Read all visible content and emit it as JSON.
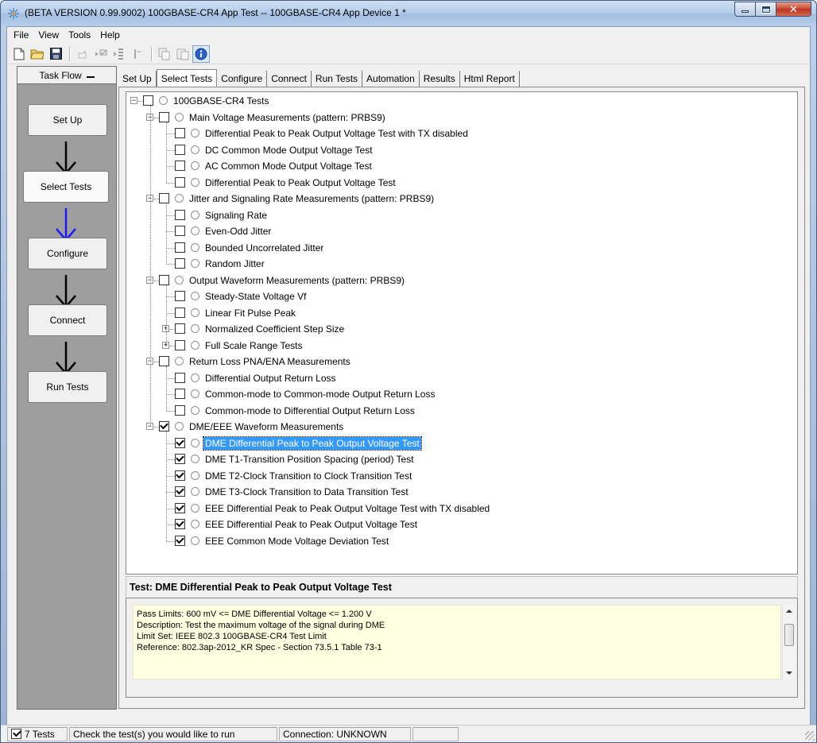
{
  "window": {
    "title": "(BETA VERSION 0.99.9002) 100GBASE-CR4 App Test -- 100GBASE-CR4 App Device 1 *",
    "app_icon": "sparkle-icon",
    "controls": {
      "minimize": "minimize-icon",
      "maximize": "maximize-icon",
      "close": "close-icon"
    }
  },
  "menu": [
    "File",
    "View",
    "Tools",
    "Help"
  ],
  "toolbar": {
    "buttons": [
      "new-file-icon",
      "open-folder-icon",
      "save-icon",
      "stop-icon",
      "run-selected-icon",
      "run-step-icon",
      "pause-icon",
      "copy-icon",
      "paste-icon",
      "info-icon"
    ]
  },
  "taskflow": {
    "header": "Task Flow",
    "steps": [
      "Set Up",
      "Select Tests",
      "Configure",
      "Connect",
      "Run Tests"
    ],
    "current_step": "Select Tests",
    "colors": {
      "arrow": "#000000",
      "current_arrow": "#1a1aff"
    }
  },
  "tabs": [
    "Set Up",
    "Select Tests",
    "Configure",
    "Connect",
    "Run Tests",
    "Automation",
    "Results",
    "Html Report"
  ],
  "active_tab": "Select Tests",
  "tree": {
    "root": {
      "label": "100GBASE-CR4 Tests",
      "checked": false
    },
    "groups": [
      {
        "label": "Main Voltage Measurements (pattern: PRBS9)",
        "checked": false,
        "items": [
          {
            "label": "Differential Peak to Peak Output Voltage Test with TX disabled",
            "checked": false
          },
          {
            "label": "DC Common Mode Output Voltage Test",
            "checked": false
          },
          {
            "label": "AC Common Mode Output Voltage Test",
            "checked": false
          },
          {
            "label": "Differential Peak to Peak Output Voltage Test",
            "checked": false
          }
        ]
      },
      {
        "label": "Jitter and Signaling Rate Measurements (pattern: PRBS9)",
        "checked": false,
        "items": [
          {
            "label": "Signaling Rate",
            "checked": false
          },
          {
            "label": "Even-Odd Jitter",
            "checked": false
          },
          {
            "label": "Bounded Uncorrelated Jitter",
            "checked": false
          },
          {
            "label": "Random Jitter",
            "checked": false
          }
        ]
      },
      {
        "label": "Output Waveform Measurements (pattern: PRBS9)",
        "checked": false,
        "items": [
          {
            "label": "Steady-State Voltage Vf",
            "checked": false
          },
          {
            "label": "Linear Fit Pulse Peak",
            "checked": false
          },
          {
            "label": "Normalized Coefficient Step Size",
            "checked": false,
            "expandable": true
          },
          {
            "label": "Full Scale Range Tests",
            "checked": false,
            "expandable": true
          }
        ]
      },
      {
        "label": "Return Loss PNA/ENA Measurements",
        "checked": false,
        "items": [
          {
            "label": "Differential Output Return Loss",
            "checked": false
          },
          {
            "label": "Common-mode to Common-mode Output Return Loss",
            "checked": false
          },
          {
            "label": "Common-mode to Differential Output Return Loss",
            "checked": false
          }
        ]
      },
      {
        "label": "DME/EEE Waveform Measurements",
        "checked": true,
        "items": [
          {
            "label": "DME Differential Peak to Peak Output Voltage Test",
            "checked": true,
            "selected": true
          },
          {
            "label": "DME T1-Transition Position Spacing (period) Test",
            "checked": true
          },
          {
            "label": "DME T2-Clock Transition to Clock Transition Test",
            "checked": true
          },
          {
            "label": "DME T3-Clock Transition to Data Transition Test",
            "checked": true
          },
          {
            "label": "EEE Differential Peak to Peak Output Voltage Test with TX disabled",
            "checked": true
          },
          {
            "label": "EEE Differential Peak to Peak Output Voltage Test",
            "checked": true
          },
          {
            "label": "EEE Common Mode Voltage Deviation Test",
            "checked": true
          }
        ]
      }
    ]
  },
  "details": {
    "title": "Test: DME Differential Peak to Peak Output Voltage Test",
    "lines": [
      "Pass Limits: 600 mV <= DME Differential Voltage <= 1.200 V",
      "Description: Test the maximum voltage of the signal during DME",
      "Limit Set: IEEE 802.3 100GBASE-CR4 Test Limit",
      "Reference: 802.3ap-2012_KR Spec - Section 73.5.1 Table 73-1"
    ]
  },
  "statusbar": {
    "tests": "7 Tests",
    "hint": "Check the test(s) you would like to run",
    "connection": "Connection: UNKNOWN"
  },
  "colors": {
    "selection": "#3399ff",
    "details_bg": "#ffffe1",
    "info_icon": "#2a62c9"
  }
}
